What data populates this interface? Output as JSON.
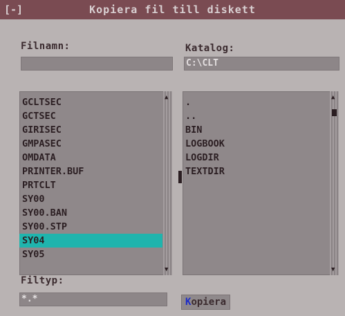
{
  "window": {
    "system_menu": "[-]",
    "title": "Kopiera fil till diskett"
  },
  "filename": {
    "label": "Filnamn:",
    "value": ""
  },
  "directory": {
    "label": "Katalog:",
    "value": "C:\\CLT"
  },
  "files": [
    "GCLTSEC",
    "GCTSEC",
    "GIRISEC",
    "GMPASEC",
    "OMDATA",
    "PRINTER.BUF",
    "PRTCLT",
    "SY00",
    "SY00.BAN",
    "SY00.STP",
    "SY04",
    "SY05"
  ],
  "selected_file_index": 10,
  "directories": [
    ".",
    "..",
    "BIN",
    "LOGBOOK",
    "LOGDIR",
    "TEXTDIR"
  ],
  "filetype": {
    "label": "Filtyp:",
    "value": "*.*"
  },
  "copy_button": {
    "hotkey": "K",
    "rest": "opiera"
  },
  "icons": {
    "scroll_up": "up-arrow-icon",
    "scroll_down": "down-arrow-icon"
  },
  "colors": {
    "title_bar": "#7a4b52",
    "selection": "#1fb4ad",
    "hotkey": "#1d2cc8"
  }
}
